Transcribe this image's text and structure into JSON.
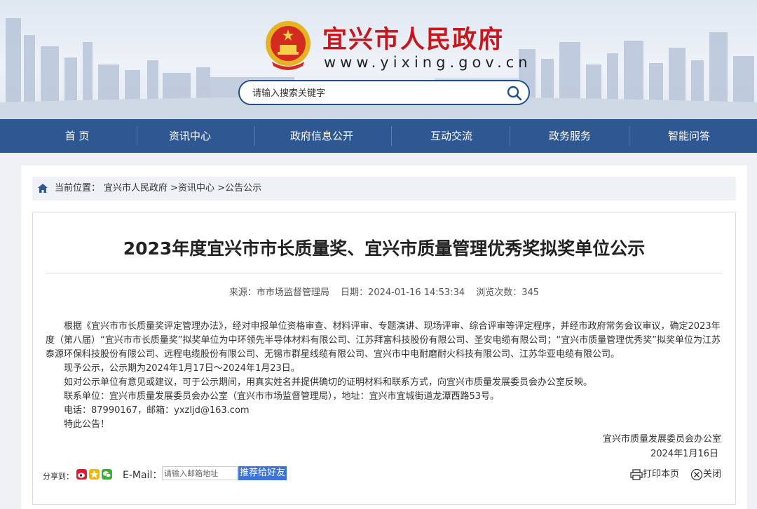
{
  "header": {
    "site_title": "宜兴市人民政府",
    "site_url": "www.yixing.gov.cn",
    "search_placeholder": "请输入搜索关键字"
  },
  "nav": {
    "items": [
      "首 页",
      "资讯中心",
      "政府信息公开",
      "互动交流",
      "政务服务",
      "智能问答"
    ]
  },
  "breadcrumb": {
    "label": "当前位置：",
    "path": [
      "宜兴市人民政府",
      ">资讯中心",
      ">公告公示"
    ]
  },
  "article": {
    "title": "2023年度宜兴市市长质量奖、宜兴市质量管理优秀奖拟奖单位公示",
    "meta": {
      "source": "来源：市市场监督管理局",
      "date": "日期：2024-01-16 14:53:34",
      "views": "浏览次数：345"
    },
    "paragraphs": [
      "根据《宜兴市市长质量奖评定管理办法》，经对申报单位资格审查、材料评审、专题演讲、现场评审、综合评审等评定程序，并经市政府常务会议审议，确定2023年度（第八届）“宜兴市市长质量奖”拟奖单位为中环领先半导体材料有限公司、江苏拜富科技股份有限公司、圣安电缆有限公司；“宜兴市质量管理优秀奖”拟奖单位为江苏泰源环保科技股份有限公司、远程电缆股份有限公司、无锡市群星线缆有限公司、宜兴市中电耐磨耐火科技有限公司、江苏华亚电缆有限公司。",
      "现予公示，公示期为2024年1月17日～2024年1月23日。",
      "如对公示单位有意见或建议，可于公示期间，用真实姓名并提供确切的证明材料和联系方式，向宜兴市质量发展委员会办公室反映。",
      "联系单位：宜兴市质量发展委员会办公室（宜兴市市场监督管理局），地址：宜兴市宜城街道龙潭西路53号。",
      "电话：87990167，邮箱：yxzljd@163.com",
      "特此公告！"
    ],
    "signature_org": "宜兴市质量发展委员会办公室",
    "signature_date": "2024年1月16日"
  },
  "share": {
    "label": "分享到：",
    "email_label": "E-Mail：",
    "email_placeholder": "请输入邮箱地址",
    "recommend": "推荐给好友",
    "print": "打印本页",
    "close": "关闭"
  },
  "colors": {
    "nav_bg": "#2f5893",
    "title_red": "#c8161d",
    "accent_blue": "#3b73d8"
  }
}
